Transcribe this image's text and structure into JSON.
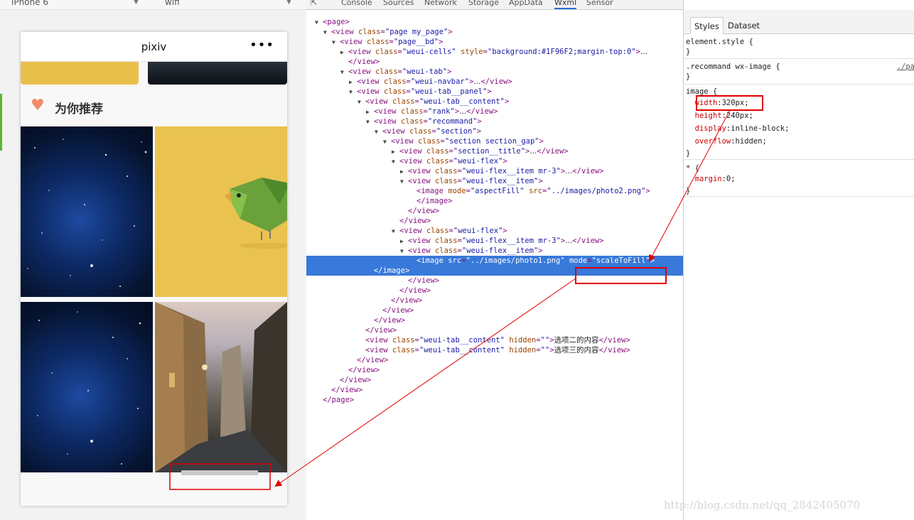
{
  "devbar": {
    "device": "iPhone 6",
    "network": "wifi"
  },
  "phone": {
    "title": "pixiv",
    "menu_dots": "•••",
    "section_title": "为你推荐",
    "heart_icon": "♥"
  },
  "devtools": {
    "tabs": [
      "Console",
      "Sources",
      "Network",
      "Storage",
      "AppData",
      "Wxml",
      "Sensor"
    ],
    "active_tab": "Wxml"
  },
  "wxml_tree": [
    {
      "indent": 0,
      "tri": "▼",
      "html": "<span class=\"tg\">&lt;page&gt;</span>"
    },
    {
      "indent": 1,
      "tri": "▼",
      "html": "<span class=\"tg\">&lt;view </span><span class=\"an\">class</span>=<span class=\"av\">\"page my_page\"</span><span class=\"tg\">&gt;</span>"
    },
    {
      "indent": 2,
      "tri": "▼",
      "html": "<span class=\"tg\">&lt;view </span><span class=\"an\">class</span>=<span class=\"av\">\"page__bd\"</span><span class=\"tg\">&gt;</span>"
    },
    {
      "indent": 3,
      "tri": "▶",
      "html": "<span class=\"tg\">&lt;view </span><span class=\"an\">class</span>=<span class=\"av\">\"weui-cells\"</span> <span class=\"an\">style</span>=<span class=\"av\">\"background:#1F96F2;margin-top:0\"</span><span class=\"tg\">&gt;</span><span class=\"tx\">...</span>"
    },
    {
      "indent": 3,
      "tri": "",
      "html": "<span class=\"tg\">&lt;/view&gt;</span>"
    },
    {
      "indent": 3,
      "tri": "▼",
      "html": "<span class=\"tg\">&lt;view </span><span class=\"an\">class</span>=<span class=\"av\">\"weui-tab\"</span><span class=\"tg\">&gt;</span>"
    },
    {
      "indent": 4,
      "tri": "▶",
      "html": "<span class=\"tg\">&lt;view </span><span class=\"an\">class</span>=<span class=\"av\">\"weui-navbar\"</span><span class=\"tg\">&gt;</span><span class=\"tx\">...</span><span class=\"tg\">&lt;/view&gt;</span>"
    },
    {
      "indent": 4,
      "tri": "▼",
      "html": "<span class=\"tg\">&lt;view </span><span class=\"an\">class</span>=<span class=\"av\">\"weui-tab__panel\"</span><span class=\"tg\">&gt;</span>"
    },
    {
      "indent": 5,
      "tri": "▼",
      "html": "<span class=\"tg\">&lt;view </span><span class=\"an\">class</span>=<span class=\"av\">\"weui-tab__content\"</span><span class=\"tg\">&gt;</span>"
    },
    {
      "indent": 6,
      "tri": "▶",
      "html": "<span class=\"tg\">&lt;view </span><span class=\"an\">class</span>=<span class=\"av\">\"rank\"</span><span class=\"tg\">&gt;</span><span class=\"tx\">...</span><span class=\"tg\">&lt;/view&gt;</span>"
    },
    {
      "indent": 6,
      "tri": "▼",
      "html": "<span class=\"tg\">&lt;view </span><span class=\"an\">class</span>=<span class=\"av\">\"recommand\"</span><span class=\"tg\">&gt;</span>"
    },
    {
      "indent": 7,
      "tri": "▼",
      "html": "<span class=\"tg\">&lt;view </span><span class=\"an\">class</span>=<span class=\"av\">\"section\"</span><span class=\"tg\">&gt;</span>"
    },
    {
      "indent": 8,
      "tri": "▼",
      "html": "<span class=\"tg\">&lt;view </span><span class=\"an\">class</span>=<span class=\"av\">\"section section_gap\"</span><span class=\"tg\">&gt;</span>"
    },
    {
      "indent": 9,
      "tri": "▶",
      "html": "<span class=\"tg\">&lt;view </span><span class=\"an\">class</span>=<span class=\"av\">\"section__title\"</span><span class=\"tg\">&gt;</span><span class=\"tx\">...</span><span class=\"tg\">&lt;/view&gt;</span>"
    },
    {
      "indent": 9,
      "tri": "▼",
      "html": "<span class=\"tg\">&lt;view </span><span class=\"an\">class</span>=<span class=\"av\">\"weui-flex\"</span><span class=\"tg\">&gt;</span>"
    },
    {
      "indent": 10,
      "tri": "▶",
      "html": "<span class=\"tg\">&lt;view </span><span class=\"an\">class</span>=<span class=\"av\">\"weui-flex__item mr-3\"</span><span class=\"tg\">&gt;</span><span class=\"tx\">...</span><span class=\"tg\">&lt;/view&gt;</span>"
    },
    {
      "indent": 10,
      "tri": "▼",
      "html": "<span class=\"tg\">&lt;view </span><span class=\"an\">class</span>=<span class=\"av\">\"weui-flex__item\"</span><span class=\"tg\">&gt;</span>"
    },
    {
      "indent": 11,
      "tri": "",
      "html": "<span class=\"tg\">&lt;image </span><span class=\"an\">mode</span>=<span class=\"av\">\"aspectFill\"</span> <span class=\"an\">src</span>=<span class=\"av\">\"../images/photo2.png\"</span><span class=\"tg\">&gt;</span>"
    },
    {
      "indent": 11,
      "tri": "",
      "html": "<span class=\"tg\">&lt;/image&gt;</span>"
    },
    {
      "indent": 10,
      "tri": "",
      "html": "<span class=\"tg\">&lt;/view&gt;</span>"
    },
    {
      "indent": 9,
      "tri": "",
      "html": "<span class=\"tg\">&lt;/view&gt;</span>"
    },
    {
      "indent": 9,
      "tri": "▼",
      "html": "<span class=\"tg\">&lt;view </span><span class=\"an\">class</span>=<span class=\"av\">\"weui-flex\"</span><span class=\"tg\">&gt;</span>"
    },
    {
      "indent": 10,
      "tri": "▶",
      "html": "<span class=\"tg\">&lt;view </span><span class=\"an\">class</span>=<span class=\"av\">\"weui-flex__item mr-3\"</span><span class=\"tg\">&gt;</span><span class=\"tx\">...</span><span class=\"tg\">&lt;/view&gt;</span>"
    },
    {
      "indent": 10,
      "tri": "▼",
      "html": "<span class=\"tg\">&lt;view </span><span class=\"an\">class</span>=<span class=\"av\">\"weui-flex__item\"</span><span class=\"tg\">&gt;</span>"
    },
    {
      "indent": 11,
      "tri": "",
      "sel": true,
      "html": "<span class=\"tg\">&lt;image </span><span class=\"an\">src</span>=<span class=\"av\">\"../images/photo1.png\"</span> <span class=\"an\">mode</span>=<span class=\"av\">\"scaleToFill\"</span><span class=\"tg\">&gt;</span><br>               <span class=\"tg\">&lt;/image&gt;</span>"
    },
    {
      "indent": 10,
      "tri": "",
      "html": "<span class=\"tg\">&lt;/view&gt;</span>"
    },
    {
      "indent": 9,
      "tri": "",
      "html": "<span class=\"tg\">&lt;/view&gt;</span>"
    },
    {
      "indent": 8,
      "tri": "",
      "html": "<span class=\"tg\">&lt;/view&gt;</span>"
    },
    {
      "indent": 7,
      "tri": "",
      "html": "<span class=\"tg\">&lt;/view&gt;</span>"
    },
    {
      "indent": 6,
      "tri": "",
      "html": "<span class=\"tg\">&lt;/view&gt;</span>"
    },
    {
      "indent": 5,
      "tri": "",
      "html": "<span class=\"tg\">&lt;/view&gt;</span>"
    },
    {
      "indent": 5,
      "tri": "",
      "html": "<span class=\"tg\">&lt;view </span><span class=\"an\">class</span>=<span class=\"av\">\"weui-tab__content\"</span> <span class=\"an\">hidden</span>=<span class=\"av\">\"\"</span><span class=\"tg\">&gt;</span><span class=\"tx\">选项二的内容</span><span class=\"tg\">&lt;/view&gt;</span>"
    },
    {
      "indent": 5,
      "tri": "",
      "html": "<span class=\"tg\">&lt;view </span><span class=\"an\">class</span>=<span class=\"av\">\"weui-tab__content\"</span> <span class=\"an\">hidden</span>=<span class=\"av\">\"\"</span><span class=\"tg\">&gt;</span><span class=\"tx\">选项三的内容</span><span class=\"tg\">&lt;/view&gt;</span>"
    },
    {
      "indent": 4,
      "tri": "",
      "html": "<span class=\"tg\">&lt;/view&gt;</span>"
    },
    {
      "indent": 3,
      "tri": "",
      "html": "<span class=\"tg\">&lt;/view&gt;</span>"
    },
    {
      "indent": 2,
      "tri": "",
      "html": "<span class=\"tg\">&lt;/view&gt;</span>"
    },
    {
      "indent": 1,
      "tri": "",
      "html": "<span class=\"tg\">&lt;/view&gt;</span>"
    },
    {
      "indent": 0,
      "tri": "",
      "html": "<span class=\"tg\">&lt;/page&gt;</span>"
    }
  ],
  "styles_panel": {
    "tabs": [
      "Styles",
      "Dataset"
    ],
    "src_link": "./pa",
    "lines": [
      {
        "html": "element.style {"
      },
      {
        "html": "}"
      },
      {
        "html": ".recommand wx-image {"
      },
      {
        "html": "}"
      },
      {
        "html": "image {"
      },
      {
        "html": "  <span class=\"prop\">width</span>:320px;"
      },
      {
        "html": "  <span class=\"prop\">height</span>:240px;"
      },
      {
        "html": "  <span class=\"prop\">display</span>:inline-block;"
      },
      {
        "html": "  <span class=\"prop\">overflow</span>:hidden;"
      },
      {
        "html": "}"
      },
      {
        "html": "* {"
      },
      {
        "html": "  <span class=\"prop\">margin</span>:0;"
      },
      {
        "html": "}"
      }
    ]
  },
  "watermark": "http://blog.csdn.net/qq_2842405070"
}
